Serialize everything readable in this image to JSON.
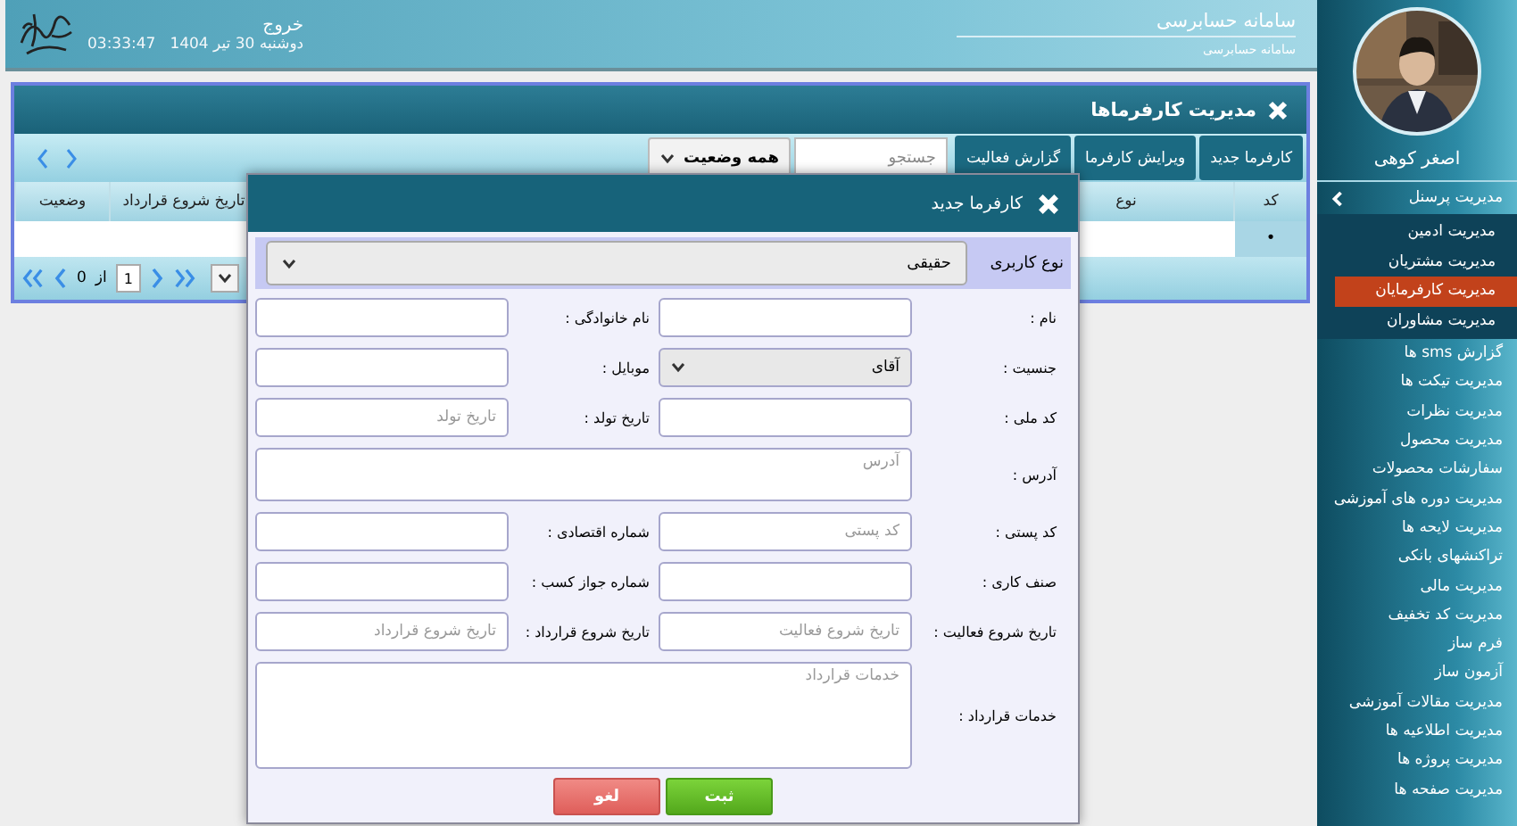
{
  "header": {
    "title": "سامانه حسابرسی",
    "subtitle": "سامانه حسابرسی",
    "logout": "خروج",
    "date": "دوشنبه 30 تیر 1404",
    "time": "03:33:47"
  },
  "sidebar": {
    "user_name": "اصغر کوهی",
    "menu": [
      {
        "label": "مدیریت پرسنل",
        "selected": false,
        "expanded": true,
        "children": [
          {
            "label": "مدیریت ادمین",
            "selected": false
          },
          {
            "label": "مدیریت مشتریان",
            "selected": false
          },
          {
            "label": "مدیریت کارفرمایان",
            "selected": true
          },
          {
            "label": "مدیریت مشاوران",
            "selected": false
          }
        ]
      },
      {
        "label": "گزارش sms ها",
        "selected": false
      },
      {
        "label": "مدیریت تیکت ها",
        "selected": false
      },
      {
        "label": "مدیریت نظرات",
        "selected": false
      },
      {
        "label": "مدیریت محصول",
        "selected": false
      },
      {
        "label": "سفارشات محصولات",
        "selected": false
      },
      {
        "label": "مدیریت دوره های آموزشی",
        "selected": false
      },
      {
        "label": "مدیریت لایحه ها",
        "selected": false
      },
      {
        "label": "تراکنشهای بانکی",
        "selected": false
      },
      {
        "label": "مدیریت مالی",
        "selected": false
      },
      {
        "label": "مدیریت کد تخفیف",
        "selected": false
      },
      {
        "label": "فرم ساز",
        "selected": false
      },
      {
        "label": "آزمون ساز",
        "selected": false
      },
      {
        "label": "مدیریت مقالات آموزشی",
        "selected": false
      },
      {
        "label": "مدیریت اطلاعیه ها",
        "selected": false
      },
      {
        "label": "مدیریت پروژه ها",
        "selected": false
      },
      {
        "label": "مدیریت صفحه ها",
        "selected": false
      }
    ]
  },
  "panel": {
    "title": "مدیریت کارفرماها",
    "toolbar_buttons": [
      "کارفرما جدید",
      "ویرایش کارفرما",
      "گزارش فعالیت"
    ],
    "search": {
      "placeholder": "جستجو"
    },
    "status_filter": {
      "value": "همه وضعیت"
    },
    "table": {
      "columns": [
        "کد",
        "نوع",
        "تاریخ شروع قرارداد",
        "وضعیت"
      ],
      "rows": [
        {
          "cells": [
            "•"
          ]
        }
      ]
    },
    "pager": {
      "page": "1",
      "of_label": "از",
      "total": "0"
    }
  },
  "dialog": {
    "title": "کارفرما جدید",
    "user_type": {
      "label": "نوع کاربری",
      "value": "حقیقی"
    },
    "fields": [
      {
        "label": "نام :",
        "kind": "text"
      },
      {
        "label": "نام خانوادگی :",
        "kind": "text"
      },
      {
        "label": "جنسیت :",
        "kind": "select",
        "value": "آقای"
      },
      {
        "label": "موبایل :",
        "kind": "text"
      },
      {
        "label": "کد ملی :",
        "kind": "text"
      },
      {
        "label": "تاریخ تولد :",
        "kind": "text",
        "placeholder": "تاریخ تولد"
      },
      {
        "label": "آدرس :",
        "kind": "textarea",
        "placeholder": "آدرس"
      },
      {
        "label": "کد پستی :",
        "kind": "text",
        "placeholder": "کد پستی"
      },
      {
        "label": "شماره اقتصادی :",
        "kind": "text"
      },
      {
        "label": "صنف کاری :",
        "kind": "text"
      },
      {
        "label": "شماره جواز کسب :",
        "kind": "text"
      },
      {
        "label": "تاریخ شروع فعالیت :",
        "kind": "text",
        "placeholder": "تاریخ شروع فعالیت"
      },
      {
        "label": "تاریخ شروع قرارداد :",
        "kind": "text",
        "placeholder": "تاریخ شروع قرارداد"
      },
      {
        "label": "خدمات قرارداد :",
        "kind": "bigtextarea",
        "placeholder": "خدمات قرارداد"
      }
    ],
    "buttons": [
      {
        "label": "ثبت",
        "kind": "submit"
      },
      {
        "label": "لغو",
        "kind": "cancel"
      }
    ]
  }
}
